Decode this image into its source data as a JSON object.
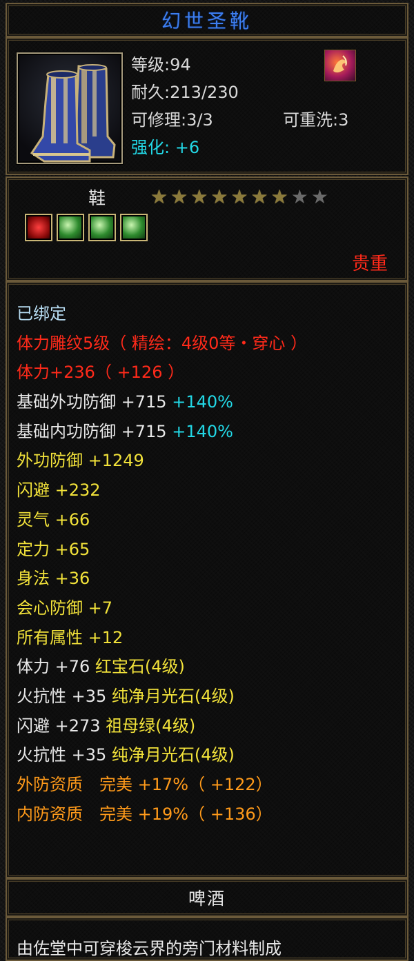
{
  "item": {
    "name": "幻世圣靴"
  },
  "stats": {
    "level": "等级:94",
    "durability": "耐久:213/230",
    "repair": "可修理:3/3",
    "rewash": "可重洗:3",
    "enhance": "强化: +6"
  },
  "type": {
    "label": "鞋",
    "stars_filled": 7,
    "stars_total": 9,
    "precious": "贵重"
  },
  "sockets": [
    "ruby-gem",
    "moonstone-gem",
    "moonstone-gem",
    "emerald-gem"
  ],
  "attributes": {
    "bound": "已绑定",
    "engrave": "体力雕纹5级（ 精绘：4级0等・穿心 ）",
    "stamina": "体力+236（ +126 ）",
    "base_ext_def": "基础外功防御 +715 ",
    "base_ext_def_pct": "+140%",
    "base_int_def": "基础内功防御 +715 ",
    "base_int_def_pct": "+140%",
    "ext_def": "外功防御 +1249",
    "dodge": "闪避 +232",
    "spirit": "灵气 +66",
    "focus": "定力 +65",
    "agility": "身法 +36",
    "crit_def": "会心防御 +7",
    "all_attr": "所有属性 +12",
    "gem1_stat": "体力 +76 ",
    "gem1_name": "红宝石(4级)",
    "gem2_stat": "火抗性 +35 ",
    "gem2_name": "纯净月光石(4级)",
    "gem3_stat": "闪避 +273 ",
    "gem3_name": "祖母绿(4级)",
    "gem4_stat": "火抗性 +35 ",
    "gem4_name": "纯净月光石(4级)",
    "ext_quality": "外防资质　完美 +17%（ +122）",
    "int_quality": "内防资质　完美 +19%（ +136）"
  },
  "footer": {
    "title": "啤酒",
    "description": "由佐堂中可穿梭云界的旁门材料制成"
  },
  "colors": {
    "title_blue": "#3d7ef0",
    "enhance_cyan": "#22d8e6",
    "precious_red": "#ff2a1a",
    "attr_yellow": "#f2e23a",
    "quality_orange": "#ff9a1a"
  }
}
